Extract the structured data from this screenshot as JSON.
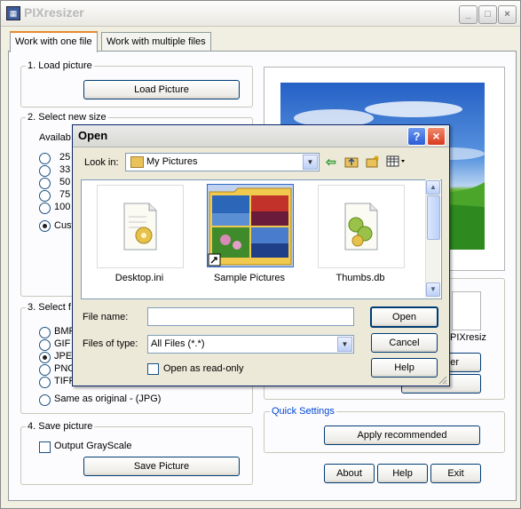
{
  "window": {
    "title": "PIXresizer"
  },
  "tabs": [
    "Work with one file",
    "Work with multiple files"
  ],
  "load": {
    "group_label": "1. Load picture",
    "button": "Load Picture"
  },
  "size": {
    "group_label": "2. Select new size",
    "available_label": "Availab",
    "options": [
      "25",
      "33",
      "50",
      "75",
      "100",
      "Cust"
    ],
    "selected_index": 5
  },
  "format": {
    "group_label": "3. Select f",
    "options": [
      "BMP",
      "GIF",
      "JPE",
      "PNG",
      "TIFF"
    ],
    "selected_index": 2,
    "same_as_original": "Same as original  - (JPG)"
  },
  "save": {
    "group_label": "4. Save picture",
    "grayscale_label": "Output GrayScale",
    "button": "Save Picture"
  },
  "right": {
    "partial_text": "PIXresiz",
    "partial_button": "er",
    "quick_settings_label": "Quick Settings",
    "apply_button": "Apply recommended"
  },
  "bottom_buttons": {
    "about": "About",
    "help": "Help",
    "exit": "Exit"
  },
  "dialog": {
    "title": "Open",
    "look_in_label": "Look in:",
    "look_in_value": "My Pictures",
    "files": [
      {
        "name": "Desktop.ini",
        "icon": "ini-file-icon"
      },
      {
        "name": "Sample Pictures",
        "icon": "folder-pictures-icon"
      },
      {
        "name": "Thumbs.db",
        "icon": "db-file-icon"
      }
    ],
    "file_name_label": "File name:",
    "file_name_value": "",
    "files_of_type_label": "Files of type:",
    "files_of_type_value": "All Files (*.*)",
    "read_only_label": "Open as read-only",
    "open_button": "Open",
    "cancel_button": "Cancel",
    "help_button": "Help"
  },
  "colors": {
    "accent_tab": "#e68b2c",
    "close_red": "#e4462f",
    "quick_settings": "#0046d5"
  }
}
